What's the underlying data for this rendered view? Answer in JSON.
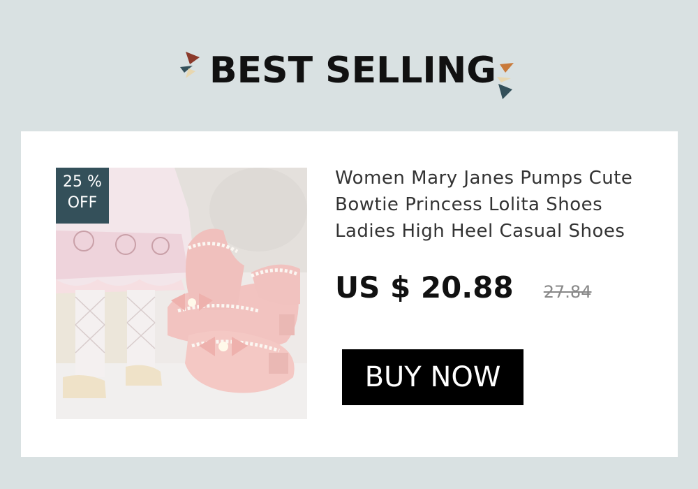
{
  "header": {
    "title": "BEST SELLING"
  },
  "product": {
    "discount_percent": "25 %",
    "discount_label": "OFF",
    "title": "Women Mary Janes Pumps Cute Bowtie Princess Lolita Shoes Ladies High Heel Casual Shoes",
    "price": "US $ 20.88",
    "original_price": "27.84",
    "buy_label": "BUY NOW"
  },
  "colors": {
    "background": "#d9e1e2",
    "badge": "#34505a",
    "button": "#000000",
    "accent_orange": "#c97a3b",
    "accent_dark": "#34505a"
  },
  "icons": {
    "left_decoration": "confetti-triangles-icon",
    "right_decoration": "confetti-triangles-icon"
  }
}
